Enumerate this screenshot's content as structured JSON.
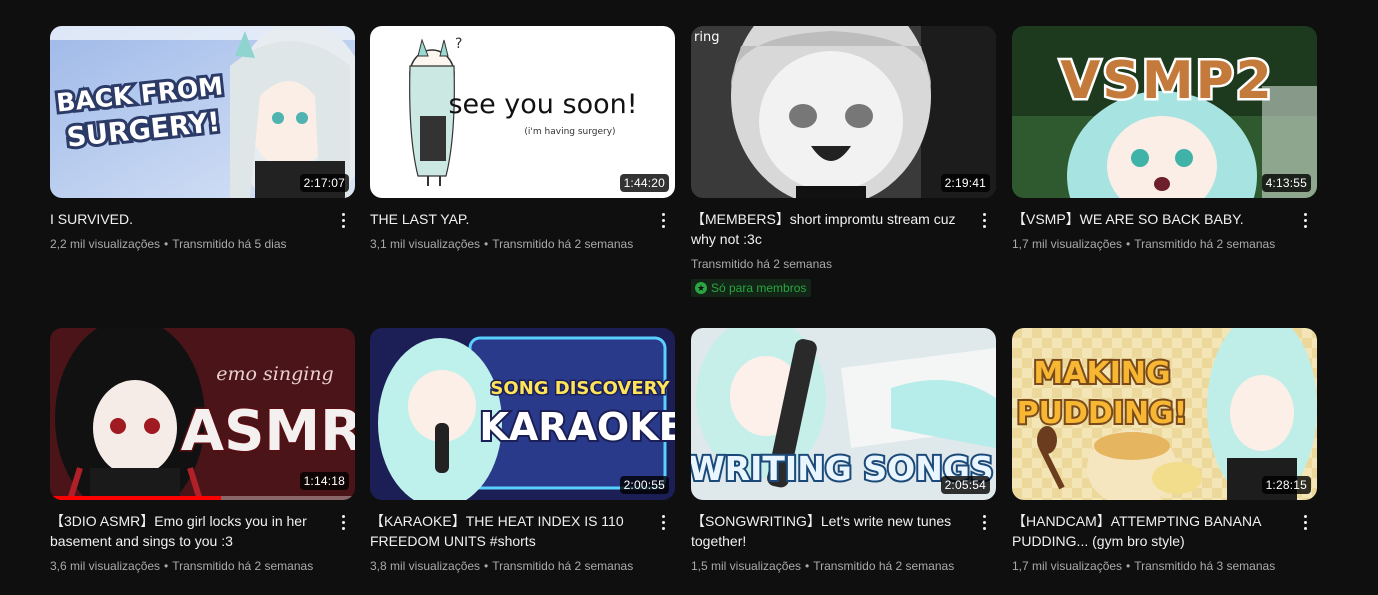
{
  "videos": [
    {
      "title": "I SURVIVED.",
      "views": "2,2 mil visualizações",
      "age": "Transmitido há 5 dias",
      "duration": "2:17:07",
      "thumb_text": [
        "BACK FROM",
        "SURGERY!"
      ]
    },
    {
      "title": "THE LAST YAP.",
      "views": "3,1 mil visualizações",
      "age": "Transmitido há 2 semanas",
      "duration": "1:44:20",
      "thumb_text": [
        "see you soon!",
        "(i'm having surgery)"
      ]
    },
    {
      "title": "【MEMBERS】short impromtu stream cuz why not :3c",
      "views": "",
      "age": "Transmitido há 2 semanas",
      "duration": "2:19:41",
      "badge": "Só para membros",
      "thumb_text": [
        "ring"
      ]
    },
    {
      "title": "【VSMP】WE ARE SO BACK BABY.",
      "views": "1,7 mil visualizações",
      "age": "Transmitido há 2 semanas",
      "duration": "4:13:55",
      "thumb_text": [
        "VSMP2"
      ]
    },
    {
      "title": "【3DIO ASMR】Emo girl locks you in her basement and sings to you :3",
      "views": "3,6 mil visualizações",
      "age": "Transmitido há 2 semanas",
      "duration": "1:14:18",
      "progress": 0.56,
      "thumb_text": [
        "emo singing",
        "ASMR"
      ]
    },
    {
      "title": "【KARAOKE】THE HEAT INDEX IS 110 FREEDOM UNITS #shorts",
      "views": "3,8 mil visualizações",
      "age": "Transmitido há 2 semanas",
      "duration": "2:00:55",
      "thumb_text": [
        "SONG DISCOVERY",
        "KARAOKE"
      ]
    },
    {
      "title": "【SONGWRITING】Let's write new tunes together!",
      "views": "1,5 mil visualizações",
      "age": "Transmitido há 2 semanas",
      "duration": "2:05:54",
      "thumb_text": [
        "WRITING SONGS"
      ]
    },
    {
      "title": "【HANDCAM】ATTEMPTING BANANA PUDDING... (gym bro style)",
      "views": "1,7 mil visualizações",
      "age": "Transmitido há 3 semanas",
      "duration": "1:28:15",
      "thumb_text": [
        "MAKING",
        "PUDDING!"
      ]
    }
  ],
  "colors": {
    "background": "#0f0f0f",
    "members_green": "#2ba640",
    "progress_red": "#ff0000"
  }
}
